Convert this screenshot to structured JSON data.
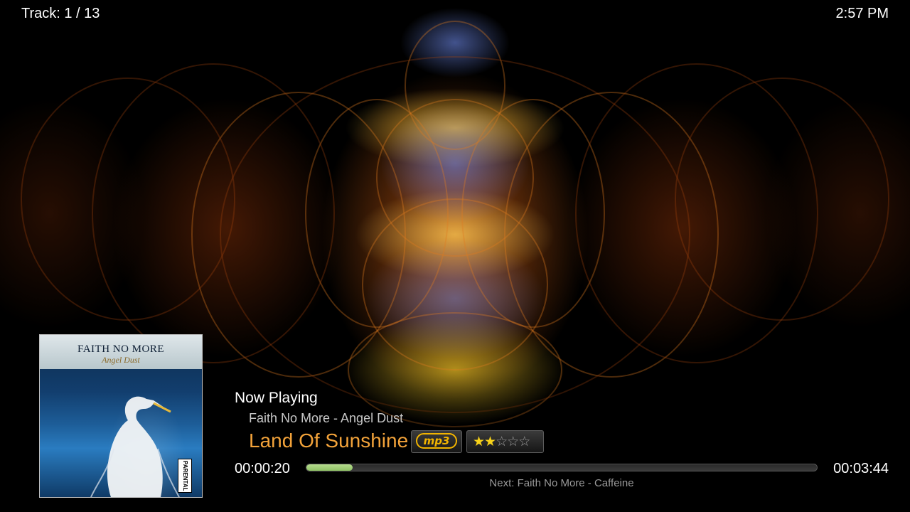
{
  "header": {
    "track_counter": "Track: 1 / 13",
    "clock": "2:57 PM"
  },
  "album_art": {
    "band_text": "FAITH NO MORE",
    "album_text": "Angel Dust",
    "advisory_text": "PARENTAL ADVISORY"
  },
  "now_playing": {
    "label": "Now Playing",
    "artist_album": "Faith No More - Angel Dust",
    "title": "Land Of Sunshine",
    "format": "mp3",
    "rating": {
      "value": 2,
      "max": 5
    }
  },
  "playback": {
    "elapsed": "00:00:20",
    "duration": "00:03:44",
    "progress_fraction": 0.09,
    "next": "Next: Faith No More - Caffeine"
  },
  "colors": {
    "title_accent": "#f3a33a",
    "progress_fill": "#8fc265",
    "star_on": "#f7d21a",
    "badge_gold": "#f2b400"
  }
}
